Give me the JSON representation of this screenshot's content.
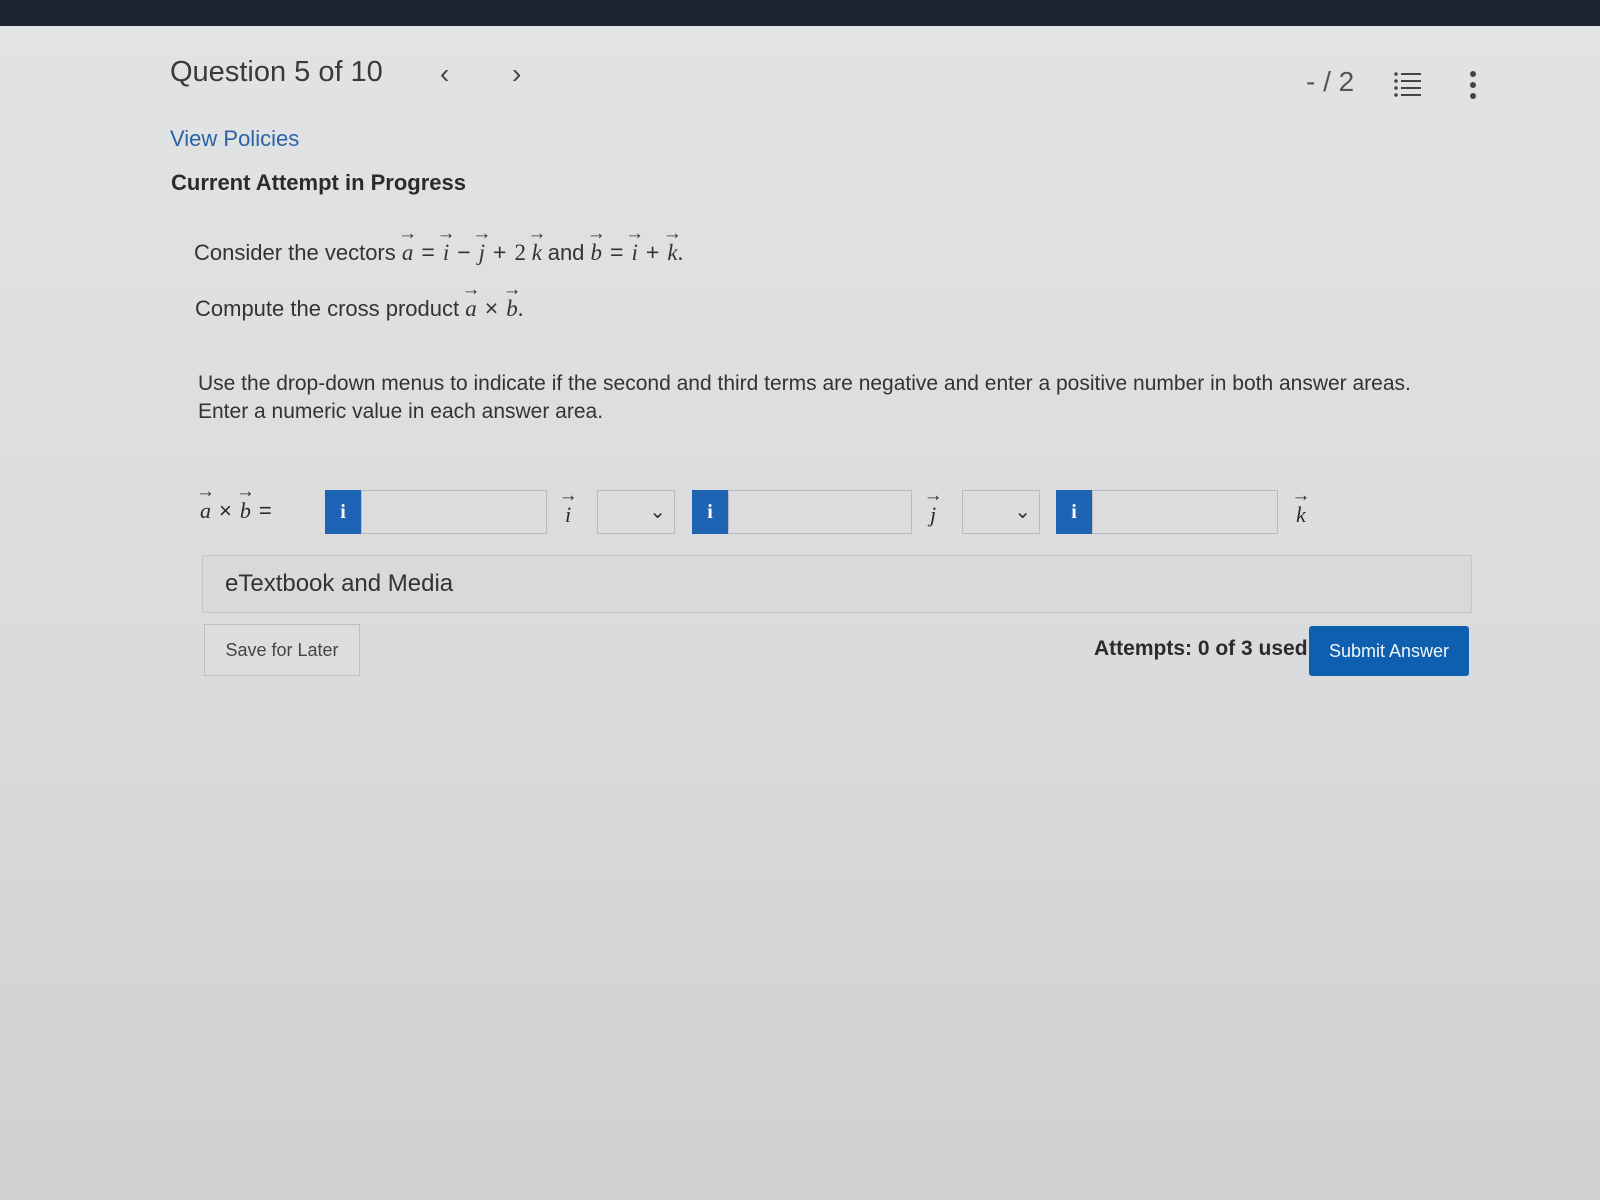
{
  "header": {
    "question_label": "Question 5 of 10",
    "prev_icon": "chevron-left-icon",
    "next_icon": "chevron-right-icon",
    "score": "- / 2",
    "list_icon": "question-list-icon",
    "more_icon": "more-vertical-icon"
  },
  "links": {
    "view_policies": "View Policies"
  },
  "attempt": {
    "title": "Current Attempt in Progress"
  },
  "problem": {
    "line1_prefix": "Consider the vectors",
    "line1_and": "and",
    "line2_prefix": "Compute the cross product",
    "vec_a": "a",
    "vec_b": "b",
    "vec_i": "i",
    "vec_j": "j",
    "vec_k": "k",
    "eq": "=",
    "minus": "−",
    "plus": "+",
    "coef_2": "2",
    "cross": "×",
    "period": "."
  },
  "instructions": {
    "line1": "Use the drop-down menus to indicate if the second and third terms are negative and enter a positive number in both answer areas.",
    "line2": "Enter a numeric value in each answer area."
  },
  "answer": {
    "lhs_a": "a",
    "lhs_b": "b",
    "lhs_cross": "×",
    "lhs_eq": "=",
    "info_label": "i",
    "unit_i": "i",
    "unit_j": "j",
    "unit_k": "k",
    "input1_value": "",
    "input2_value": "",
    "input3_value": "",
    "select1_value": "",
    "select2_value": ""
  },
  "etextbook": {
    "label": "eTextbook and Media"
  },
  "footer": {
    "save_label": "Save for Later",
    "attempts_text": "Attempts: 0 of 3 used",
    "submit_label": "Submit Answer"
  },
  "colors": {
    "accent": "#1e63b4",
    "submit_bg": "#0e5fb0",
    "link": "#2a63a8",
    "topbar": "#1d2432"
  }
}
